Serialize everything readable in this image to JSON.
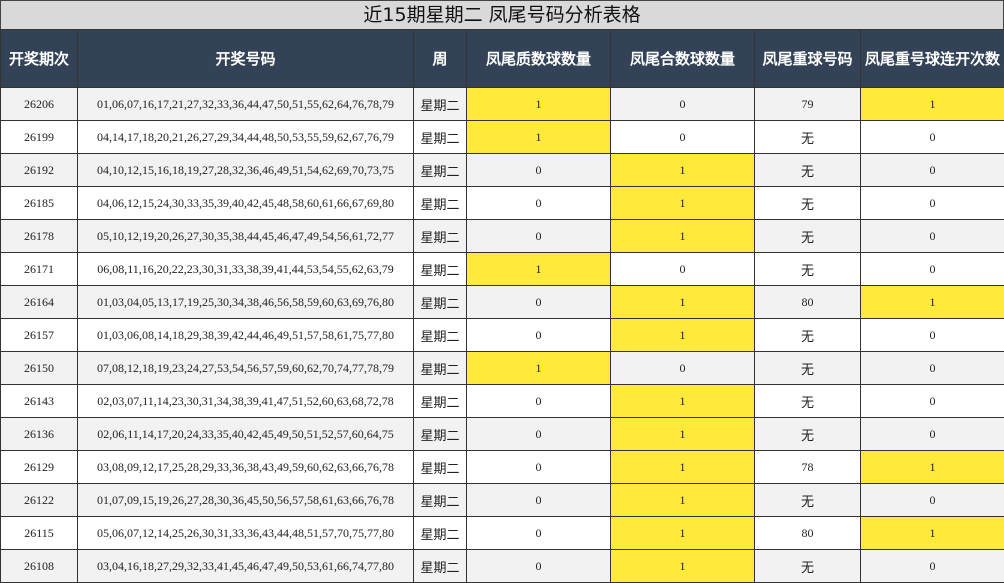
{
  "title": "近15期星期二 凤尾号码分析表格",
  "headers": [
    "开奖期次",
    "开奖号码",
    "周",
    "凤尾质数球数量",
    "凤尾合数球数量",
    "凤尾重球号码",
    "凤尾重号球连开次数"
  ],
  "highlight_color": "#ffe93b",
  "header_color": "#334256",
  "rows": [
    {
      "period": "26206",
      "numbers": "01,06,07,16,17,21,27,32,33,36,44,47,50,51,55,62,64,76,78,79",
      "week": "星期二",
      "prime": "1",
      "composite": "0",
      "repeat": "79",
      "streak": "1"
    },
    {
      "period": "26199",
      "numbers": "04,14,17,18,20,21,26,27,29,34,44,48,50,53,55,59,62,67,76,79",
      "week": "星期二",
      "prime": "1",
      "composite": "0",
      "repeat": "无",
      "streak": "0"
    },
    {
      "period": "26192",
      "numbers": "04,10,12,15,16,18,19,27,28,32,36,46,49,51,54,62,69,70,73,75",
      "week": "星期二",
      "prime": "0",
      "composite": "1",
      "repeat": "无",
      "streak": "0"
    },
    {
      "period": "26185",
      "numbers": "04,06,12,15,24,30,33,35,39,40,42,45,48,58,60,61,66,67,69,80",
      "week": "星期二",
      "prime": "0",
      "composite": "1",
      "repeat": "无",
      "streak": "0"
    },
    {
      "period": "26178",
      "numbers": "05,10,12,19,20,26,27,30,35,38,44,45,46,47,49,54,56,61,72,77",
      "week": "星期二",
      "prime": "0",
      "composite": "1",
      "repeat": "无",
      "streak": "0"
    },
    {
      "period": "26171",
      "numbers": "06,08,11,16,20,22,23,30,31,33,38,39,41,44,53,54,55,62,63,79",
      "week": "星期二",
      "prime": "1",
      "composite": "0",
      "repeat": "无",
      "streak": "0"
    },
    {
      "period": "26164",
      "numbers": "01,03,04,05,13,17,19,25,30,34,38,46,56,58,59,60,63,69,76,80",
      "week": "星期二",
      "prime": "0",
      "composite": "1",
      "repeat": "80",
      "streak": "1"
    },
    {
      "period": "26157",
      "numbers": "01,03,06,08,14,18,29,38,39,42,44,46,49,51,57,58,61,75,77,80",
      "week": "星期二",
      "prime": "0",
      "composite": "1",
      "repeat": "无",
      "streak": "0"
    },
    {
      "period": "26150",
      "numbers": "07,08,12,18,19,23,24,27,53,54,56,57,59,60,62,70,74,77,78,79",
      "week": "星期二",
      "prime": "1",
      "composite": "0",
      "repeat": "无",
      "streak": "0"
    },
    {
      "period": "26143",
      "numbers": "02,03,07,11,14,23,30,31,34,38,39,41,47,51,52,60,63,68,72,78",
      "week": "星期二",
      "prime": "0",
      "composite": "1",
      "repeat": "无",
      "streak": "0"
    },
    {
      "period": "26136",
      "numbers": "02,06,11,14,17,20,24,33,35,40,42,45,49,50,51,52,57,60,64,75",
      "week": "星期二",
      "prime": "0",
      "composite": "1",
      "repeat": "无",
      "streak": "0"
    },
    {
      "period": "26129",
      "numbers": "03,08,09,12,17,25,28,29,33,36,38,43,49,59,60,62,63,66,76,78",
      "week": "星期二",
      "prime": "0",
      "composite": "1",
      "repeat": "78",
      "streak": "1"
    },
    {
      "period": "26122",
      "numbers": "01,07,09,15,19,26,27,28,30,36,45,50,56,57,58,61,63,66,76,78",
      "week": "星期二",
      "prime": "0",
      "composite": "1",
      "repeat": "无",
      "streak": "0"
    },
    {
      "period": "26115",
      "numbers": "05,06,07,12,14,25,26,30,31,33,36,43,44,48,51,57,70,75,77,80",
      "week": "星期二",
      "prime": "0",
      "composite": "1",
      "repeat": "80",
      "streak": "1"
    },
    {
      "period": "26108",
      "numbers": "03,04,16,18,27,29,32,33,41,45,46,47,49,50,53,61,66,74,77,80",
      "week": "星期二",
      "prime": "0",
      "composite": "1",
      "repeat": "无",
      "streak": "0"
    }
  ]
}
